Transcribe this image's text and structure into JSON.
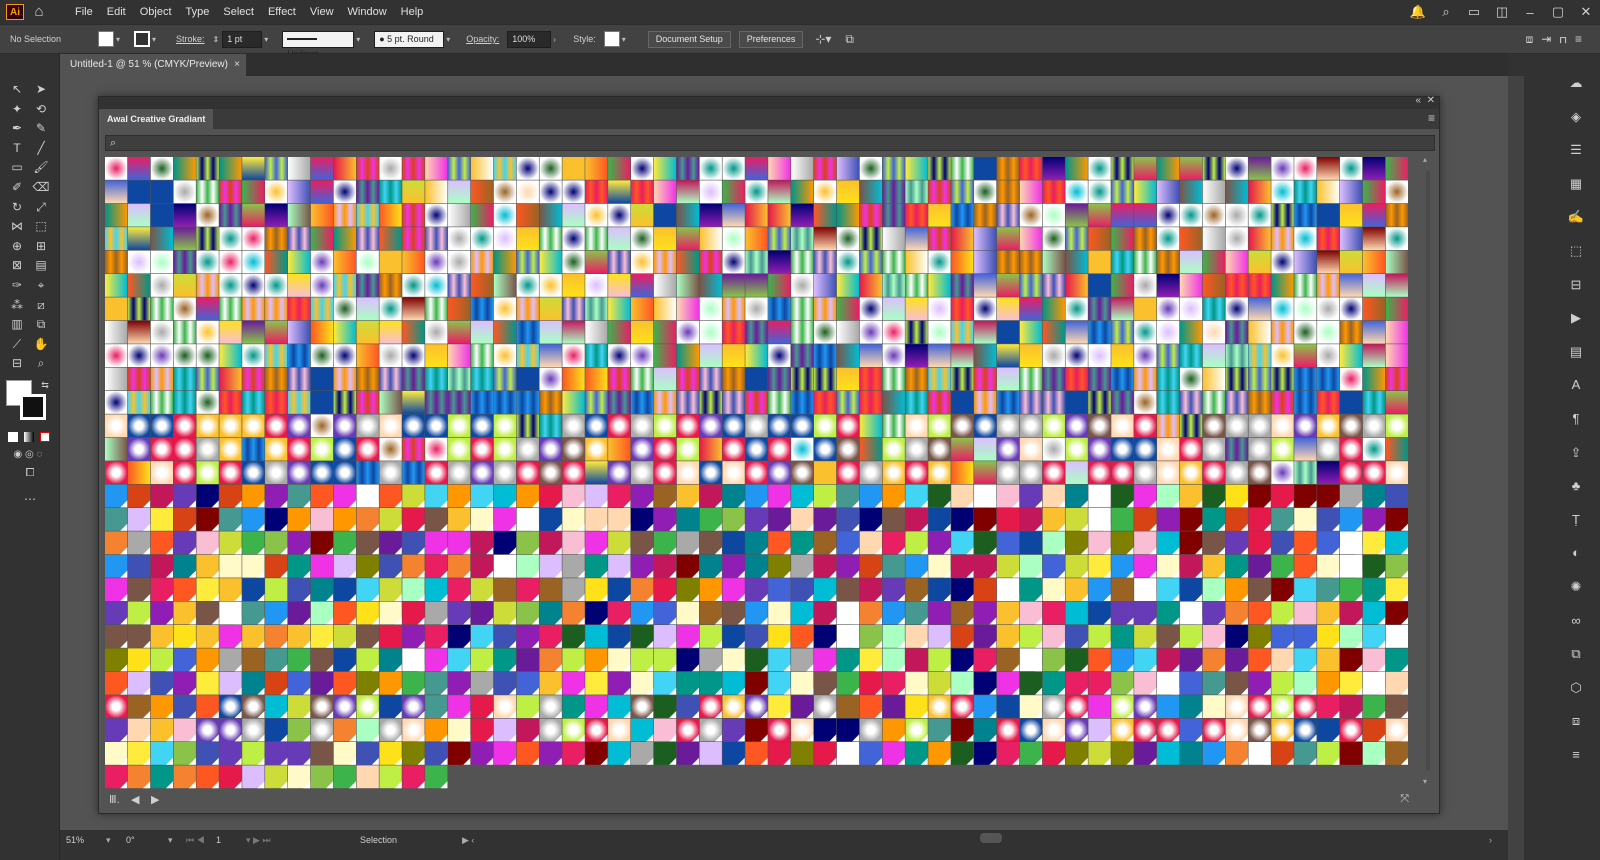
{
  "app": {
    "logo": "Ai"
  },
  "menu": [
    "File",
    "Edit",
    "Object",
    "Type",
    "Select",
    "Effect",
    "View",
    "Window",
    "Help"
  ],
  "control_bar": {
    "selection_label": "No Selection",
    "stroke_label": "Stroke:",
    "stroke_weight": "1 pt",
    "profile": "Uniform",
    "brush": "5 pt. Round",
    "opacity_label": "Opacity:",
    "opacity_value": "100%",
    "style_label": "Style:",
    "document_setup": "Document Setup",
    "preferences": "Preferences"
  },
  "document_tab": {
    "title": "Untitled-1 @ 51 % (CMYK/Preview)",
    "close": "×"
  },
  "panel": {
    "title": "Awal Creative Gradiant",
    "search_placeholder": ""
  },
  "status": {
    "zoom": "51%",
    "rotation": "0°",
    "artboard": "1",
    "tool": "Selection"
  },
  "icons": {
    "home": "home-icon",
    "search": "search-icon",
    "notifications": "bell-icon",
    "panel_menu": "hamburger-icon",
    "library": "library-icon"
  },
  "palette": [
    "#e6194b",
    "#f58231",
    "#ffe119",
    "#bfef45",
    "#3cb44b",
    "#42d4f4",
    "#4363d8",
    "#911eb4",
    "#f032e6",
    "#a9a9a9",
    "#fabed4",
    "#ffd8b1",
    "#fffac8",
    "#aaffc3",
    "#dcbeff",
    "#469990",
    "#000075",
    "#800000",
    "#9a6324",
    "#808000",
    "#e91e63",
    "#00bcd4",
    "#8bc34a",
    "#ff9800",
    "#673ab7",
    "#009688",
    "#cddc39",
    "#ff5722",
    "#3f51b5",
    "#ffeb3b",
    "#795548",
    "#2196f3",
    "#ffffff",
    "#c2185b",
    "#1b5e20",
    "#0d47a1",
    "#fbc02d",
    "#6a1b9a",
    "#00838f",
    "#d84315"
  ]
}
